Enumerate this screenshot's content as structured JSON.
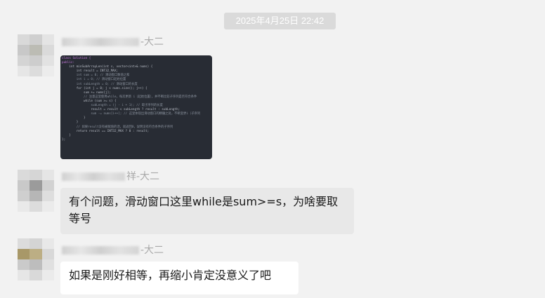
{
  "chat": {
    "timestamp": "2025年4月25日 22:42"
  },
  "messages": [
    {
      "sender_suffix": "-大二",
      "code_lines": [
        "class Solution {",
        "public:",
        "    int minSubArrayLen(int s, vector<int>& nums) {",
        "        int result = INT32_MAX;",
        "        int sum = 0; // 滑动窗口数值之和",
        "        int i = 0; // 滑动窗口起始位置",
        "        int subLength = 0; // 滑动窗口的长度",
        "        for (int j = 0; j < nums.size(); j++) {",
        "            sum += nums[j];",
        "            // 注意这里使用while，每次更新 i（起始位置），并不断比较子序列是否符合条件",
        "            while (sum >= s) {",
        "                subLength = (j - i + 1); // 取子序列的长度",
        "                result = result < subLength ? result : subLength;",
        "                sum -= nums[i++]; // 这里体现出滑动窗口的精髓之处，不断变更i（子序列",
        "            }",
        "        }",
        "        // 如果result没有被赋值的话，就返回0，说明没有符合条件的子序列",
        "        return result == INT32_MAX ? 0 : result;",
        "    }",
        "};"
      ]
    },
    {
      "sender_suffix": "祥-大二",
      "text": "有个问题，滑动窗口这里while是sum>=s，为啥要取等号"
    },
    {
      "sender_suffix": "-大二",
      "text": "如果是刚好相等，再缩小肯定没意义了吧"
    }
  ],
  "colors": {
    "background": "#f2f2f2",
    "bubble_other": "#e8e8e8",
    "bubble_white": "#ffffff",
    "code_bg": "#282c34"
  }
}
